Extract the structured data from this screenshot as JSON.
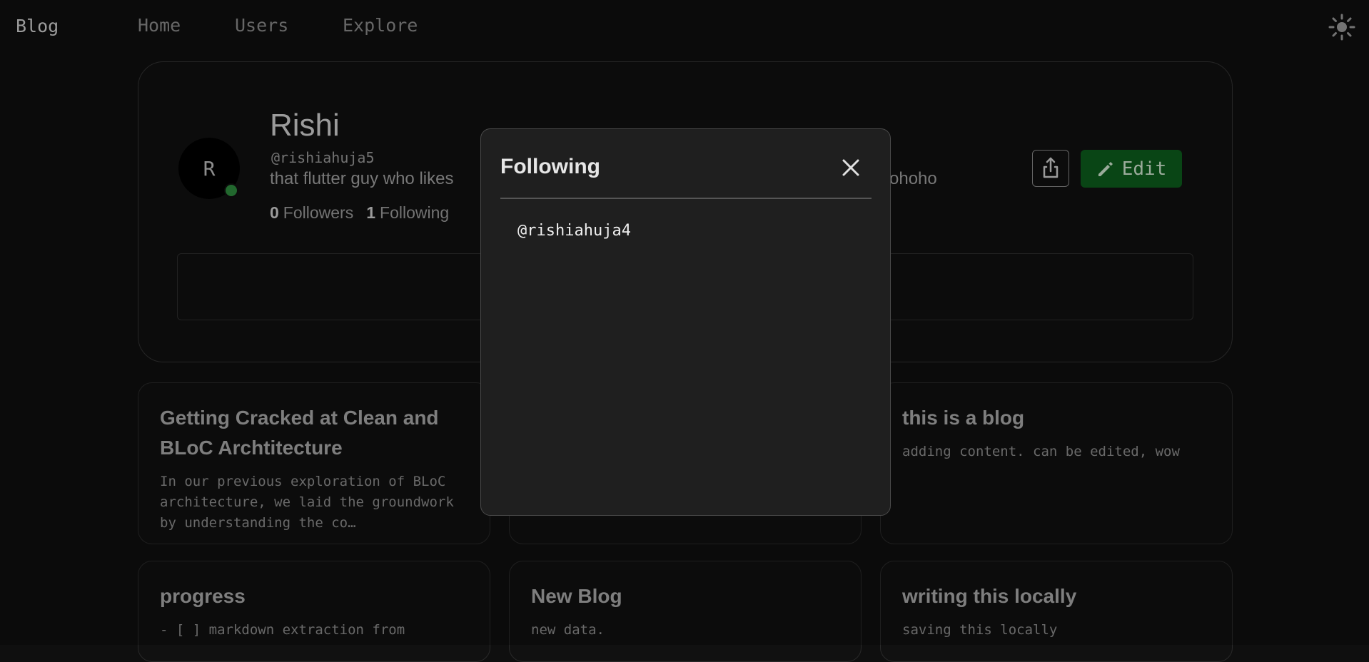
{
  "nav": {
    "brand": "Blog",
    "links": [
      "Home",
      "Users",
      "Explore"
    ],
    "theme_icon": "sun-icon"
  },
  "profile": {
    "avatar_letter": "R",
    "name": "Rishi",
    "handle": "@rishiahuja5",
    "bio_visible_start": "that flutter guy who likes",
    "bio_visible_end": "ohoho",
    "followers_count": "0",
    "followers_label": "Followers",
    "following_count": "1",
    "following_label": "Following",
    "share_icon": "share-icon",
    "edit_label": "Edit",
    "edit_icon": "pencil-icon",
    "online_color": "#2e8b3e",
    "edit_color": "#0c5c1c"
  },
  "posts": [
    {
      "title": "Getting Cracked at Clean and BLoC Archtitecture",
      "excerpt": "In our previous exploration of BLoC architecture, we laid the groundwork by understanding the co…"
    },
    {
      "title": "",
      "excerpt": ""
    },
    {
      "title": "this is a blog",
      "excerpt": "adding content. can be edited, wow"
    },
    {
      "title": "progress",
      "excerpt": "- [ ] markdown extraction from"
    },
    {
      "title": "New Blog",
      "excerpt": "new data."
    },
    {
      "title": "writing this locally",
      "excerpt": "saving this locally"
    }
  ],
  "modal": {
    "title": "Following",
    "close_icon": "close-icon",
    "items": [
      "@rishiahuja4"
    ]
  }
}
